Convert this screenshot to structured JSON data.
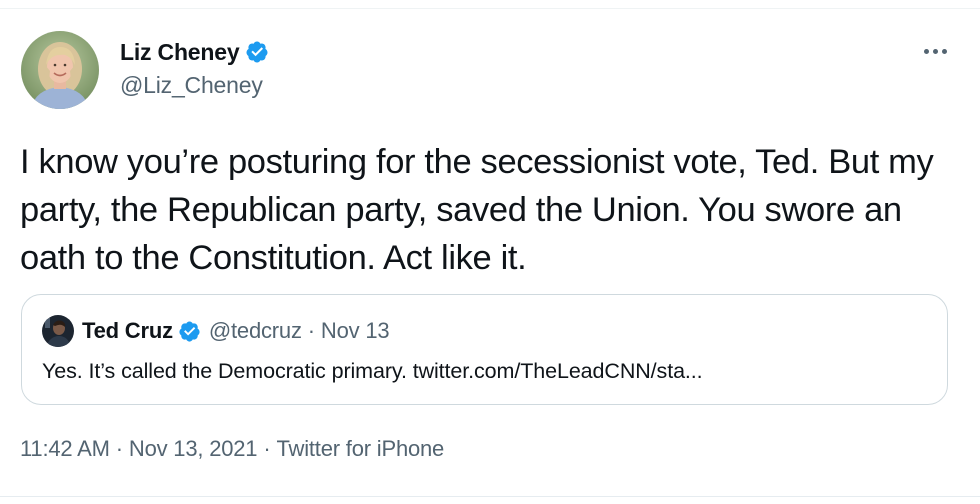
{
  "tweet": {
    "author": {
      "display_name": "Liz Cheney",
      "handle": "@Liz_Cheney",
      "verified": true,
      "avatar_icon": "profile-photo"
    },
    "more_icon": "more-horizontal-icon",
    "text": "I know you’re posturing for the secessionist vote, Ted. But my party, the Republican party, saved the Union. You swore an oath to the Constitution. Act like it.",
    "quoted_tweet": {
      "display_name": "Ted Cruz",
      "handle": "@tedcruz",
      "separator": "·",
      "date": "Nov 13",
      "verified": true,
      "text": "Yes. It’s called the Democratic primary. twitter.com/TheLeadCNN/sta..."
    },
    "meta": {
      "time": "11:42 AM",
      "separator": "·",
      "date": "Nov 13, 2021",
      "source": "Twitter for iPhone"
    }
  },
  "colors": {
    "verified_blue": "#1d9bf0",
    "secondary_text": "#536471",
    "primary_text": "#0f1419",
    "border": "#cfd9de"
  }
}
